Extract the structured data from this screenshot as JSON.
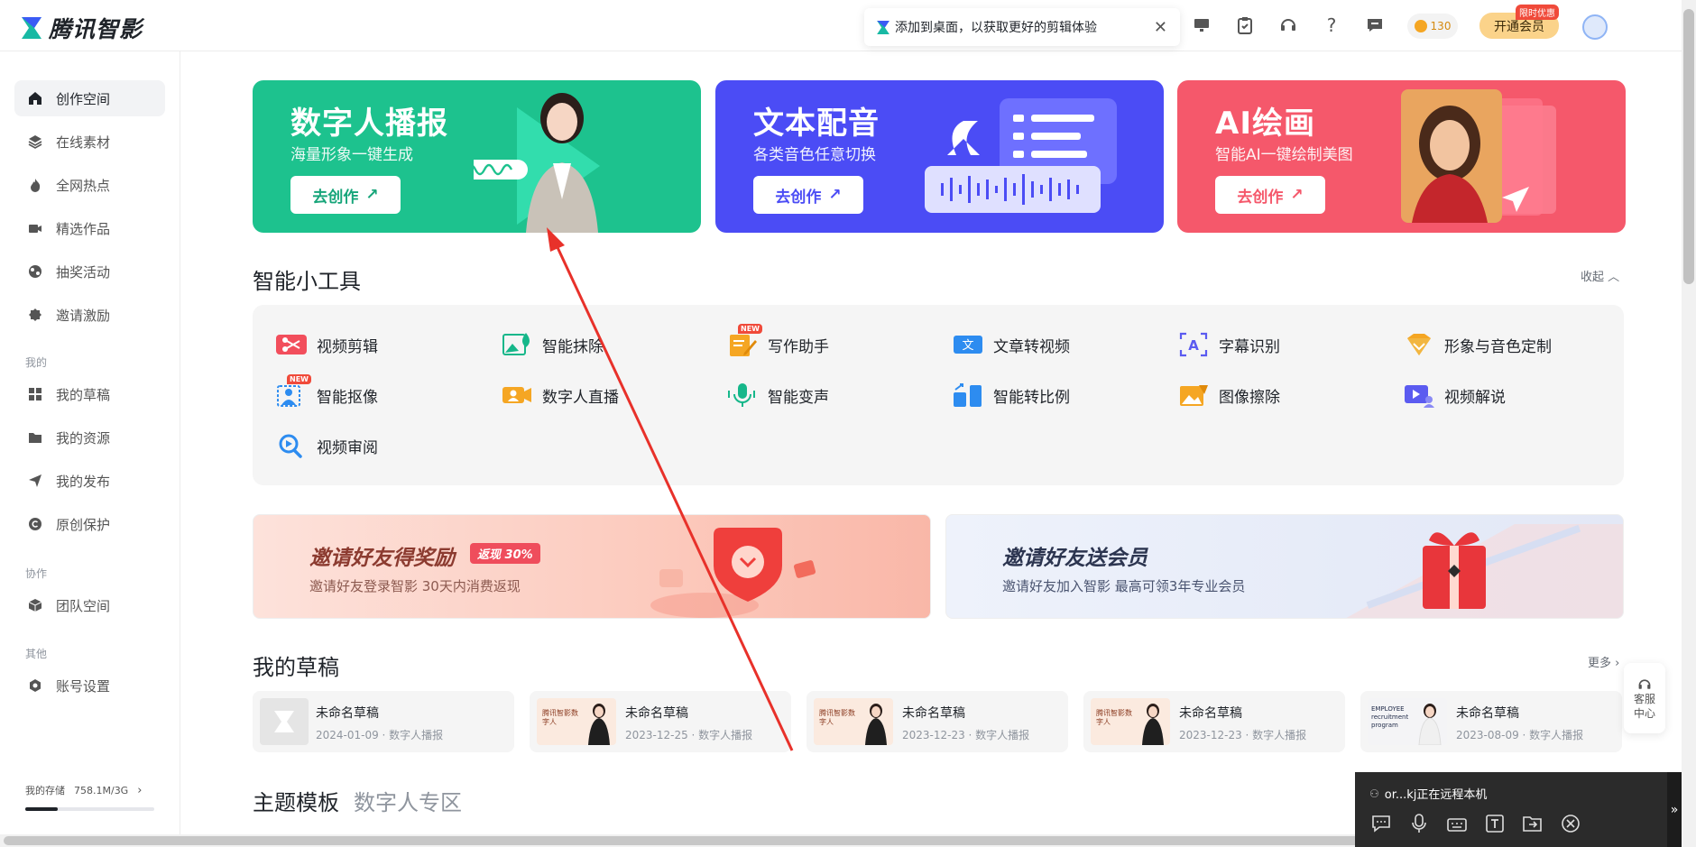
{
  "app": {
    "logo_text": "腾讯智影"
  },
  "notice": {
    "text": "添加到桌面，以获取更好的剪辑体验",
    "close": "✕"
  },
  "header": {
    "coins": "130",
    "vip_label": "开通会员",
    "vip_tag": "限时优惠"
  },
  "sidebar": {
    "items": [
      {
        "label": "创作空间"
      },
      {
        "label": "在线素材"
      },
      {
        "label": "全网热点"
      },
      {
        "label": "精选作品"
      },
      {
        "label": "抽奖活动"
      },
      {
        "label": "邀请激励"
      }
    ],
    "group_mine": "我的",
    "mine_items": [
      {
        "label": "我的草稿"
      },
      {
        "label": "我的资源"
      },
      {
        "label": "我的发布"
      },
      {
        "label": "原创保护"
      }
    ],
    "group_collab": "协作",
    "collab_items": [
      {
        "label": "团队空间"
      }
    ],
    "group_other": "其他",
    "other_items": [
      {
        "label": "账号设置"
      }
    ],
    "storage_label": "我的存储",
    "storage_value": "758.1M/3G",
    "storage_fraction": 0.25
  },
  "hero": [
    {
      "title": "数字人播报",
      "subtitle": "海量形象一键生成",
      "button": "去创作",
      "color": "#1dc28e"
    },
    {
      "title": "文本配音",
      "subtitle": "各类音色任意切换",
      "button": "去创作",
      "color": "#4b4cf5"
    },
    {
      "title": "AI绘画",
      "subtitle": "智能AI一键绘制美图",
      "button": "去创作",
      "color": "#f5586b"
    }
  ],
  "tools_section": {
    "title": "智能小工具",
    "collapse": "收起"
  },
  "tools": [
    {
      "label": "视频剪辑",
      "new": false
    },
    {
      "label": "智能抹除",
      "new": false
    },
    {
      "label": "写作助手",
      "new": true
    },
    {
      "label": "文章转视频",
      "new": false
    },
    {
      "label": "字幕识别",
      "new": false
    },
    {
      "label": "形象与音色定制",
      "new": false
    },
    {
      "label": "智能抠像",
      "new": true
    },
    {
      "label": "数字人直播",
      "new": false
    },
    {
      "label": "智能变声",
      "new": false
    },
    {
      "label": "智能转比例",
      "new": false
    },
    {
      "label": "图像擦除",
      "new": false
    },
    {
      "label": "视频解说",
      "new": false
    },
    {
      "label": "视频审阅",
      "new": false
    }
  ],
  "new_tag": "NEW",
  "banners": [
    {
      "title": "邀请好友得奖励",
      "tag": "返现 30%",
      "subtitle": "邀请好友登录智影 30天内消费返现"
    },
    {
      "title": "邀请好友送会员",
      "subtitle": "邀请好友加入智影 最高可领3年专业会员"
    }
  ],
  "drafts_section": {
    "title": "我的草稿",
    "more": "更多"
  },
  "drafts": [
    {
      "name": "未命名草稿",
      "meta": "2024-01-09 · 数字人播报"
    },
    {
      "name": "未命名草稿",
      "meta": "2023-12-25 · 数字人播报"
    },
    {
      "name": "未命名草稿",
      "meta": "2023-12-23 · 数字人播报"
    },
    {
      "name": "未命名草稿",
      "meta": "2023-12-23 · 数字人播报"
    },
    {
      "name": "未命名草稿",
      "meta": "2023-08-09 · 数字人播报"
    }
  ],
  "draft_thumb_text": "腾讯智影数字人",
  "draft_thumb_text_en": "EMPLOYEE recruitment program",
  "service": {
    "line1": "客服",
    "line2": "中心"
  },
  "bottom_tabs": {
    "tab1": "主题模板",
    "tab2": "数字人专区"
  },
  "remote": {
    "text": "or...kj正在远程本机"
  },
  "colors": {
    "accent_green": "#1dc28e",
    "accent_purple": "#4b4cf5",
    "accent_red": "#f5586b",
    "annotation_arrow": "#e8312a"
  }
}
